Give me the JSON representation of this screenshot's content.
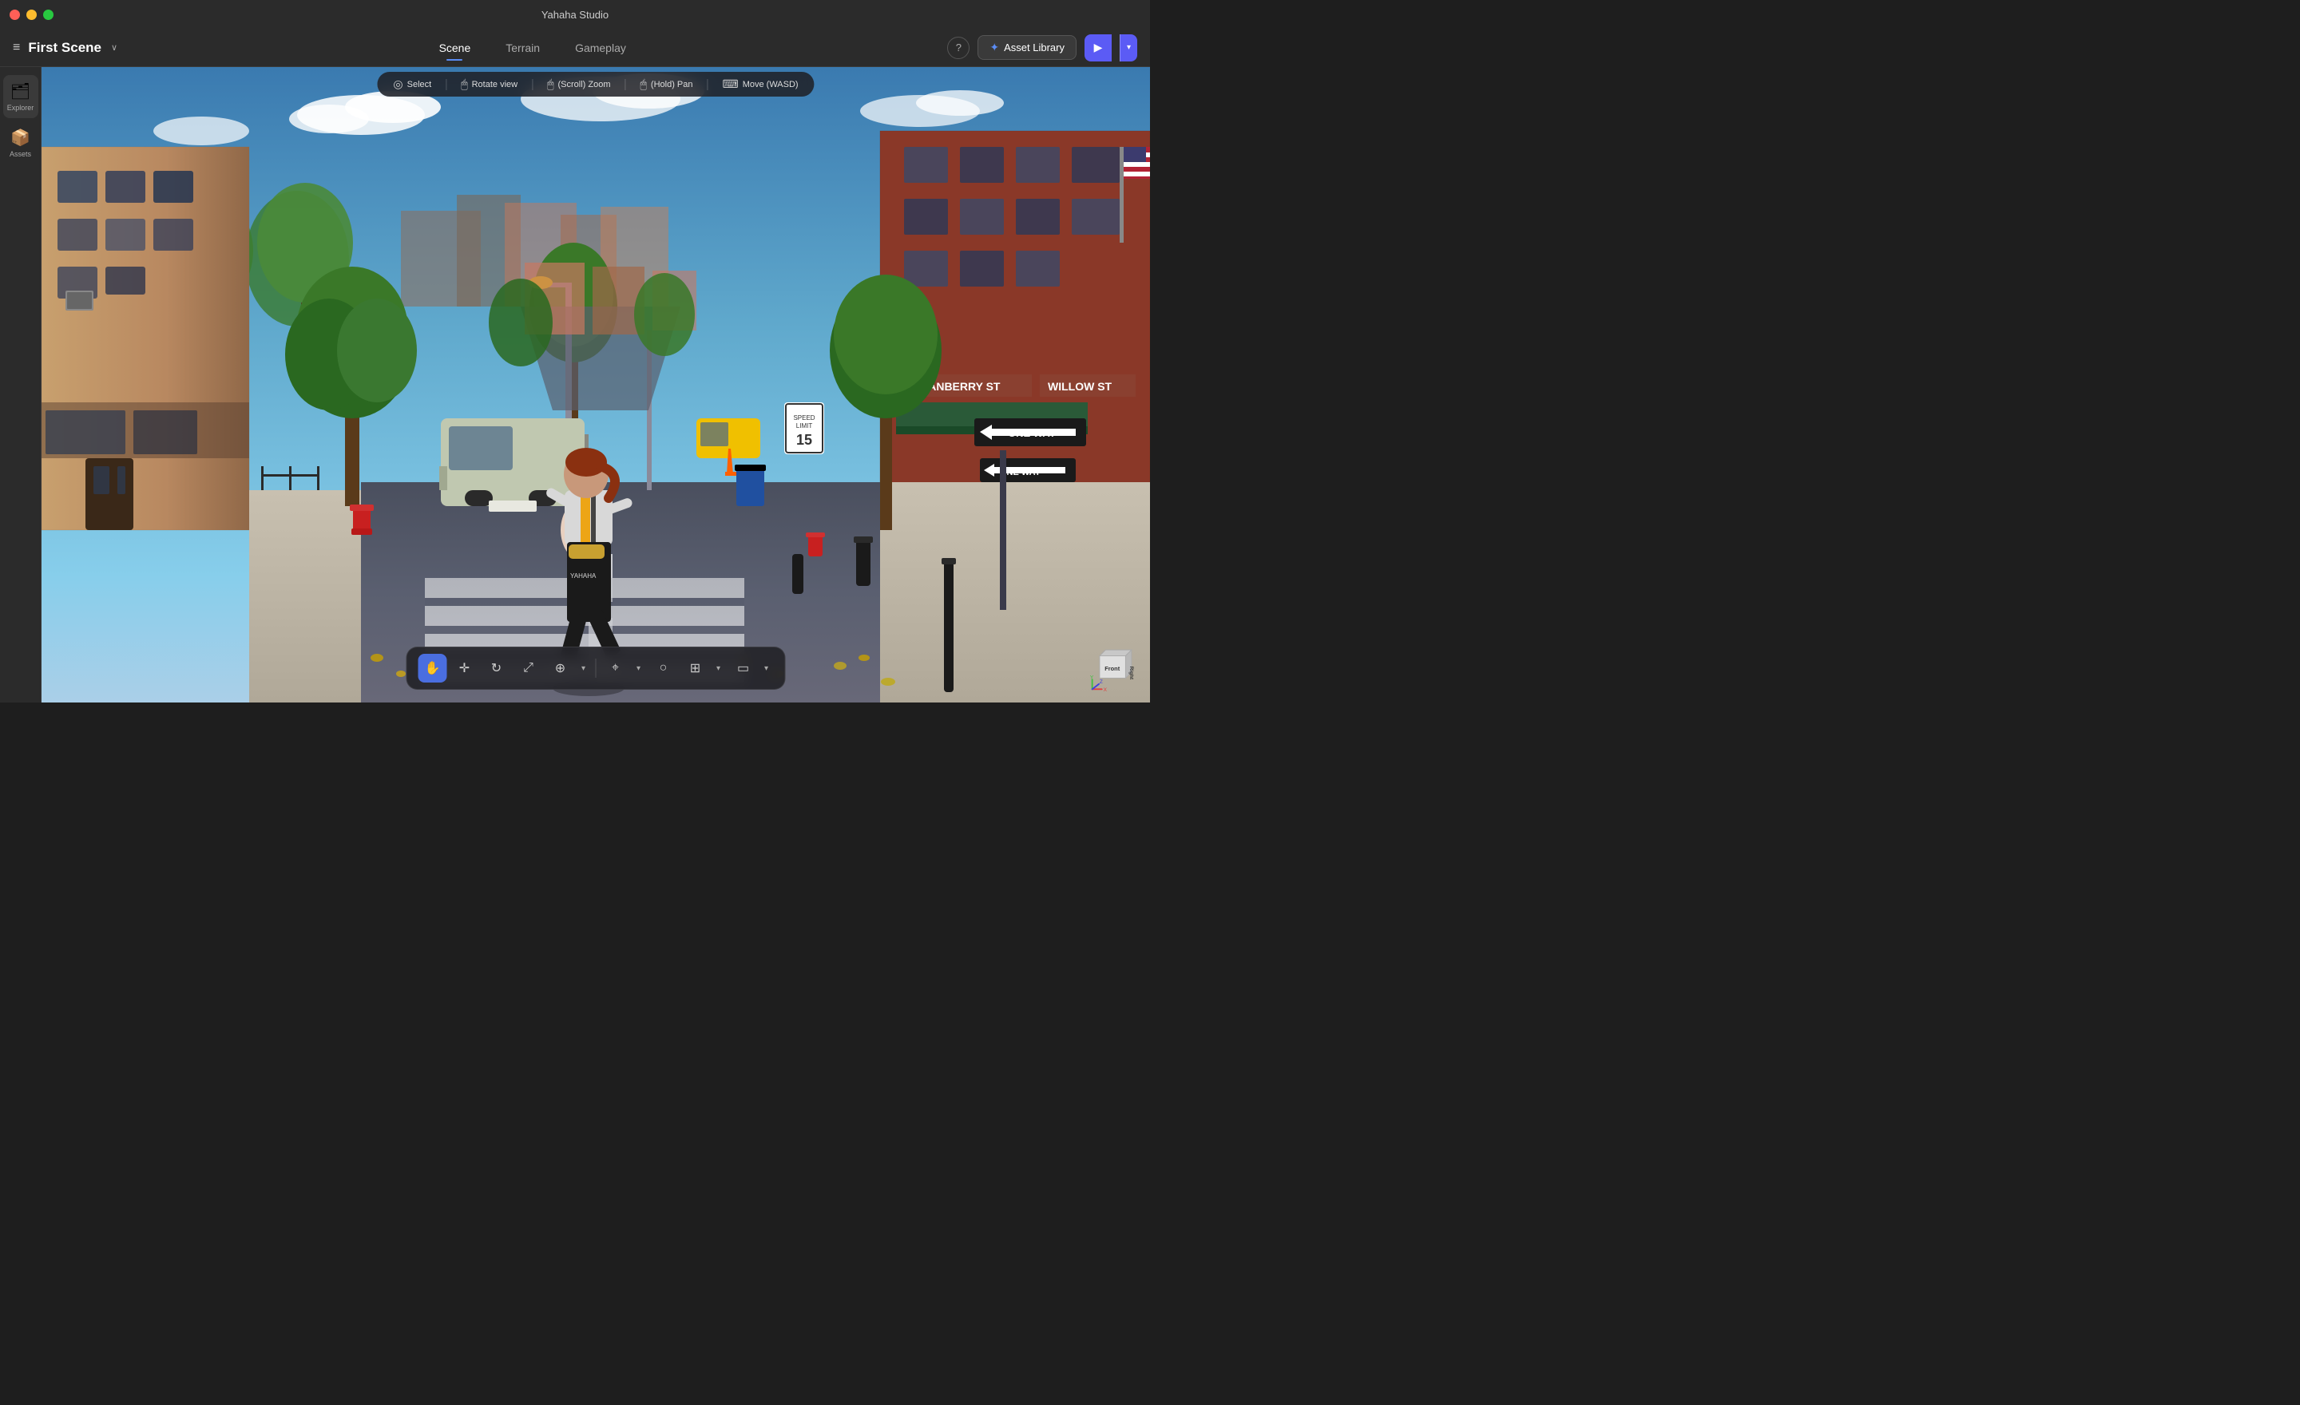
{
  "app": {
    "title": "Yahaha Studio",
    "window_title": "Yahaha Studio"
  },
  "traffic_lights": {
    "red": "red",
    "yellow": "yellow",
    "green": "green"
  },
  "toolbar": {
    "hamburger": "≡",
    "scene_title": "First Scene",
    "chevron": "∨",
    "tabs": [
      {
        "id": "scene",
        "label": "Scene",
        "active": true
      },
      {
        "id": "terrain",
        "label": "Terrain",
        "active": false
      },
      {
        "id": "gameplay",
        "label": "Gameplay",
        "active": false
      }
    ],
    "help_label": "?",
    "asset_library_label": "Asset Library",
    "play_label": "▶",
    "play_dropdown": "▾"
  },
  "sidebar": {
    "items": [
      {
        "id": "explorer",
        "label": "Explorer",
        "icon": "🗂"
      },
      {
        "id": "assets",
        "label": "Assets",
        "icon": "📦"
      }
    ]
  },
  "controls_bar": {
    "items": [
      {
        "id": "select",
        "icon": "👆",
        "label": "Select"
      },
      {
        "id": "rotate",
        "icon": "🖱",
        "label": "Rotate view"
      },
      {
        "id": "zoom",
        "icon": "🖱",
        "label": "(Scroll) Zoom"
      },
      {
        "id": "pan",
        "icon": "🖱",
        "label": "(Hold) Pan"
      },
      {
        "id": "move",
        "icon": "⌨",
        "label": "Move (WASD)"
      }
    ]
  },
  "scene": {
    "street_sign_1": "ONE WAY",
    "street_sign_2": "ONE WAY",
    "street_sign_3": "CRANBERRY ST",
    "street_sign_4": "WILLOW ST",
    "speed_limit": "15"
  },
  "bottom_toolbar": {
    "tools": [
      {
        "id": "hand",
        "icon": "✋",
        "active": true,
        "label": "Hand"
      },
      {
        "id": "move",
        "icon": "✛",
        "active": false,
        "label": "Move"
      },
      {
        "id": "rotate",
        "icon": "↻",
        "active": false,
        "label": "Rotate"
      },
      {
        "id": "scale",
        "icon": "⤢",
        "active": false,
        "label": "Scale"
      },
      {
        "id": "transform",
        "icon": "⊕",
        "active": false,
        "label": "Transform"
      },
      {
        "id": "snap",
        "icon": "⌖",
        "active": false,
        "label": "Snap"
      },
      {
        "id": "circle",
        "icon": "○",
        "active": false,
        "label": "Circle"
      },
      {
        "id": "grid",
        "icon": "⊞",
        "active": false,
        "label": "Grid"
      },
      {
        "id": "frame",
        "icon": "▭",
        "active": false,
        "label": "Frame"
      }
    ]
  },
  "orientation_cube": {
    "front_label": "Front",
    "right_label": "Right"
  },
  "colors": {
    "accent_blue": "#5b5bf5",
    "tab_active_underline": "#5b8cf5",
    "toolbar_bg": "#2b2b2b",
    "sidebar_bg": "#2b2b2b",
    "active_tool_bg": "#4a6ee0"
  }
}
